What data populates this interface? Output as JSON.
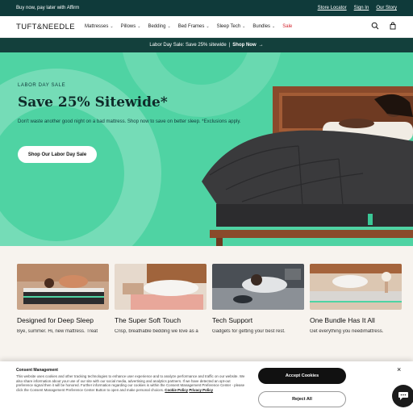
{
  "topbar": {
    "promo": "Buy now, pay later with Affirm",
    "links": [
      "Store Locator",
      "Sign In",
      "Our Story"
    ]
  },
  "nav": {
    "logo": "TUFT&NEEDLE",
    "items": [
      {
        "label": "Mattresses",
        "chevron": true
      },
      {
        "label": "Pillows",
        "chevron": true
      },
      {
        "label": "Bedding",
        "chevron": true
      },
      {
        "label": "Bed Frames",
        "chevron": true
      },
      {
        "label": "Sleep Tech",
        "chevron": true
      },
      {
        "label": "Bundles",
        "chevron": true
      },
      {
        "label": "Sale",
        "chevron": false
      }
    ],
    "icons": [
      "search-icon",
      "bag-icon"
    ]
  },
  "strip": {
    "text": "Labor Day Sale: Save 25% sitewide",
    "divider": "|",
    "cta": "Shop Now",
    "arrow": "→"
  },
  "hero": {
    "eyebrow": "LABOR DAY SALE",
    "title": "Save 25% Sitewide*",
    "subtitle": "Don't waste another good night on a bad mattress. Shop now to save on better sleep. *Exclusions apply.",
    "cta": "Shop Our Labor Day Sale"
  },
  "cards": [
    {
      "title": "Designed for Deep Sleep",
      "desc": "Bye, summer. Hi, new mattress. Treat"
    },
    {
      "title": "The Super Soft Touch",
      "desc": "Crisp, breathable bedding we love as a"
    },
    {
      "title": "Tech Support",
      "desc": "Gadgets for getting your best rest."
    },
    {
      "title": "One Bundle Has It All",
      "desc": "Get everything you needimattress."
    }
  ],
  "consent": {
    "heading": "Consent Management",
    "body": "This website uses cookies and other tracking technologies to enhance user experience and to analyze performance and traffic on our website. We also share information about your use of our site with our social media, advertising and analytics partners. If we have detected an opt-out preference signal then it will be honored. Further information regarding our cookies is within the Consent Management Preference Center - please click the Consent Management Preference Center Button to open and make personal choices.",
    "cookie_policy": "Cookie Policy",
    "privacy_policy": "Privacy Policy",
    "accept": "Accept Cookies",
    "reject": "Reject All",
    "close": "×"
  },
  "colors": {
    "topbar": "#0f3a3a",
    "hero_bg": "#4fd3a3",
    "sale": "#d3232d",
    "accept_bg": "#111111"
  }
}
